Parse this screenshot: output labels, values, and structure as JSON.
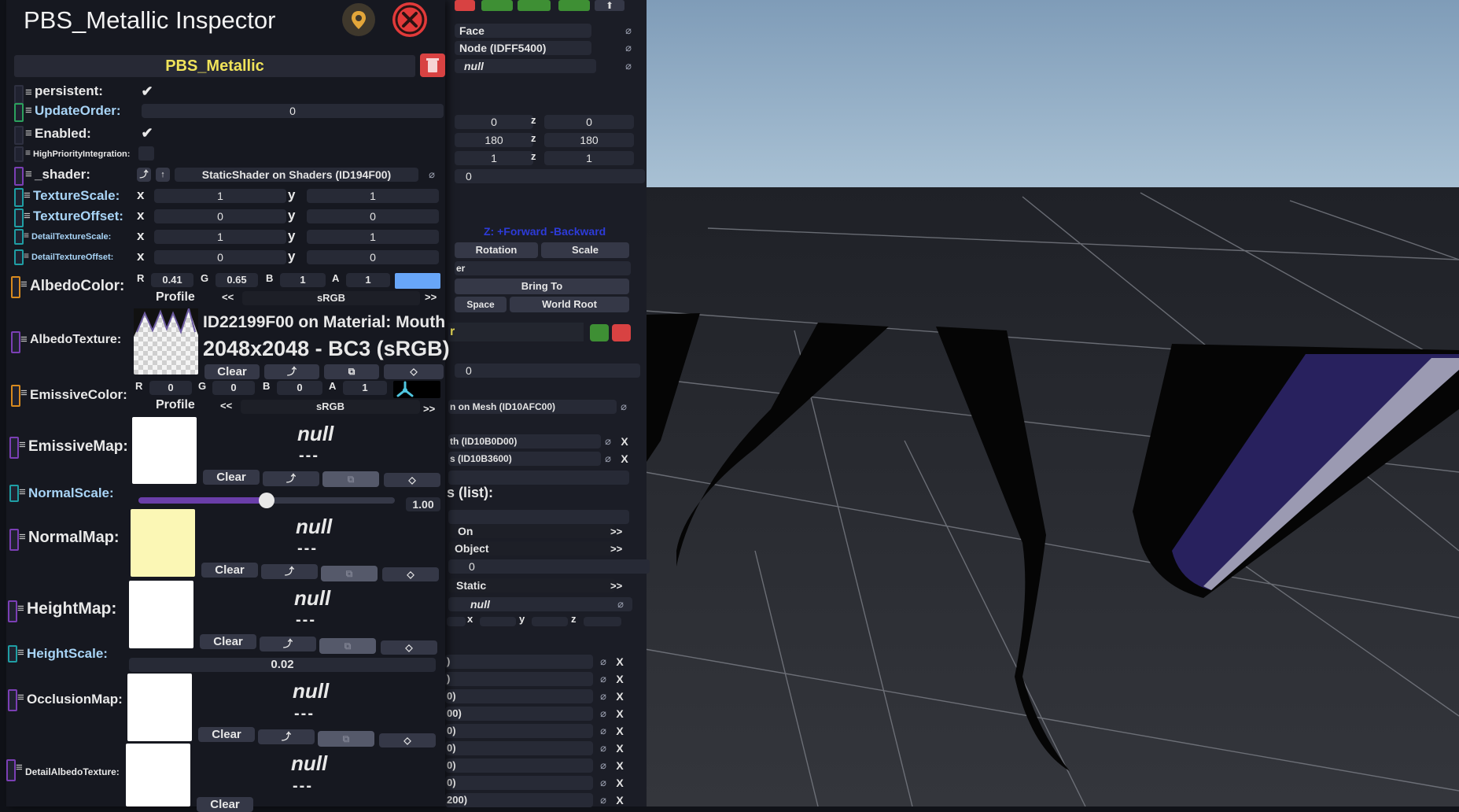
{
  "colors": {
    "accent_yellow": "#f0e35a",
    "albedo_swatch": "#68a6f8",
    "normal_map_swatch": "#fbf7b5",
    "close_button": "#e23a3a",
    "pin_button": "#3f382c",
    "delete_red": "#d84242",
    "copy_green": "#3e8f34"
  },
  "inspector": {
    "title": "PBS_Metallic Inspector",
    "component_name": "PBS_Metallic",
    "persistent_label": "persistent:",
    "update_order_label": "UpdateOrder:",
    "update_order_value": "0",
    "enabled_label": "Enabled:",
    "high_priority_label": "HighPriorityIntegration:",
    "shader_label": "_shader:",
    "shader_value": "StaticShader on Shaders (ID194F00)",
    "texture_scale_label": "TextureScale:",
    "texture_scale": {
      "x": "1",
      "y": "1"
    },
    "texture_offset_label": "TextureOffset:",
    "texture_offset": {
      "x": "0",
      "y": "0"
    },
    "detail_texture_scale_label": "DetailTextureScale:",
    "detail_texture_scale": {
      "x": "1",
      "y": "1"
    },
    "detail_texture_offset_label": "DetailTextureOffset:",
    "detail_texture_offset": {
      "x": "0",
      "y": "0"
    },
    "axis_x": "x",
    "axis_y": "y",
    "albedo_color_label": "AlbedoColor:",
    "albedo_color": {
      "r": "0.41",
      "g": "0.65",
      "b": "1",
      "a": "1"
    },
    "ch_r": "R",
    "ch_g": "G",
    "ch_b": "B",
    "ch_a": "A",
    "profile_label": "Profile",
    "profile_value": "sRGB",
    "prev_arrow": "<<",
    "next_arrow": ">>",
    "albedo_texture_label": "AlbedoTexture:",
    "albedo_texture_line1": "ID22199F00 on Material: Mouth",
    "albedo_texture_line2": "2048x2048 - BC3 (sRGB)",
    "clear_label": "Clear",
    "emissive_color_label": "EmissiveColor:",
    "emissive_color": {
      "r": "0",
      "g": "0",
      "b": "0",
      "a": "1"
    },
    "emissive_map_label": "EmissiveMap:",
    "null_text": "null",
    "null_dash": "---",
    "normal_scale_label": "NormalScale:",
    "normal_scale_value": "1.00",
    "normal_scale_fraction": 0.5,
    "normal_map_label": "NormalMap:",
    "height_map_label": "HeightMap:",
    "height_scale_label": "HeightScale:",
    "height_scale_value": "0.02",
    "occlusion_map_label": "OcclusionMap:",
    "detail_albedo_label": "DetailAlbedoTexture:"
  },
  "back_panel": {
    "row_face": "Face",
    "row_node": "Node (IDFF5400)",
    "row_null": "null",
    "pos": {
      "x": "0",
      "z_label": "z",
      "z": "0"
    },
    "rot": {
      "x": "180",
      "z_label": "z",
      "z": "180"
    },
    "scl": {
      "x": "1",
      "z_label": "z",
      "z": "1"
    },
    "row_zero": "0",
    "forward_hint": "Z: +Forward -Backward",
    "btn_rotation": "Rotation",
    "btn_scale": "Scale",
    "row_er": "er",
    "btn_bring_to": "Bring To",
    "btn_space": "Space",
    "btn_world_root": "World Root",
    "row_r": "r",
    "row_zero2": "0",
    "row_mesh": "n on Mesh (ID10AFC00)",
    "row_th": "th (ID10B0D00)",
    "row_s": "s (ID10B3600)",
    "list_header": "s (list):",
    "row_on": "On",
    "row_object": "Object",
    "row_zero3": "0",
    "row_static": "Static",
    "row_null2": "null",
    "tiny_x": "x",
    "tiny_y": "y",
    "tiny_z": "z",
    "list_items": [
      ")",
      ")",
      "0)",
      "00)",
      "0)",
      "0)",
      "0)",
      "0)",
      "200)"
    ]
  }
}
